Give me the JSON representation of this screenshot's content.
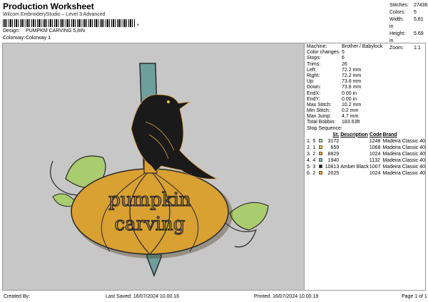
{
  "header": {
    "title": "Production Worksheet",
    "subtitle": "Wilcom EmbroideryStudio – Level 3 Advanced",
    "barcode_tail": ",",
    "design_label": "Design:",
    "design_value": "PUMPKM CARVING 5,8IN",
    "colorway_label": "Colorway:",
    "colorway_value": "Colorway 1"
  },
  "summary": [
    {
      "k": "Stitches:",
      "v": "27436"
    },
    {
      "k": "Colors:",
      "v": "5"
    },
    {
      "k": "Width:",
      "v": "5.81 in"
    },
    {
      "k": "Height:",
      "v": "5.69 in"
    },
    {
      "k": "Zoom:",
      "v": "1:1"
    }
  ],
  "design_text": {
    "line1": "pumpkin",
    "line2": "carving"
  },
  "info": [
    {
      "k": "Machine:",
      "v": "Brother / Babylock"
    },
    {
      "k": "Color changes:",
      "v": "5"
    },
    {
      "k": "Stops:",
      "v": "6"
    },
    {
      "k": "Trims:",
      "v": "26"
    },
    {
      "k": "Left:",
      "v": "72.2 mm"
    },
    {
      "k": "Right:",
      "v": "72.2 mm"
    },
    {
      "k": "Up:",
      "v": "73.8 mm"
    },
    {
      "k": "Down:",
      "v": "73.8 mm"
    },
    {
      "k": "EndX:",
      "v": "0.00 in"
    },
    {
      "k": "EndY:",
      "v": "0.00 in"
    },
    {
      "k": "Max Stitch:",
      "v": "10.2 mm"
    },
    {
      "k": "Min Stitch:",
      "v": "0.2 mm"
    },
    {
      "k": "Max Jump:",
      "v": "4.7 mm"
    },
    {
      "k": "Total Bobbin:",
      "v": "183.63ft"
    }
  ],
  "stop_sequence": {
    "label": "Stop Sequence:",
    "headers": {
      "st": "St.",
      "desc": "Description",
      "code": "Code",
      "brand": "Brand"
    },
    "rows": [
      {
        "n": "1.",
        "c": "5",
        "color": "#b6d99a",
        "st": "3172",
        "desc": "",
        "code": "1248",
        "brand": "Madeira Classic 40"
      },
      {
        "n": "2.",
        "c": "1",
        "color": "#f2c94c",
        "st": "659",
        "desc": "",
        "code": "1068",
        "brand": "Madeira Classic 40"
      },
      {
        "n": "3.",
        "c": "2",
        "color": "#e6a33a",
        "st": "8829",
        "desc": "",
        "code": "1024",
        "brand": "Madeira Classic 40"
      },
      {
        "n": "4.",
        "c": "4",
        "color": "#7fb8c4",
        "st": "1940",
        "desc": "",
        "code": "1132",
        "brand": "Madeira Classic 40"
      },
      {
        "n": "5.",
        "c": "3",
        "color": "#1a1a1a",
        "st": "10813",
        "desc": "Amber Black",
        "code": "1007",
        "brand": "Madeira Classic 40"
      },
      {
        "n": "6.",
        "c": "2",
        "color": "#e6a33a",
        "st": "2025",
        "desc": "",
        "code": "1024",
        "brand": "Madeira Classic 40"
      }
    ]
  },
  "footer": {
    "created": "Created By:",
    "saved": "Last Saved: 16/07/2024 10.00.16",
    "printed": "Printed: 16/07/2024 10.00.19",
    "page": "Page 1 of 1"
  },
  "colors": {
    "canvas": "#c7c7c7",
    "pumpkin": "#d9a032",
    "stake": "#6f9e9e",
    "leaf": "#a9cc6e",
    "raven": "#1a1a1a"
  }
}
